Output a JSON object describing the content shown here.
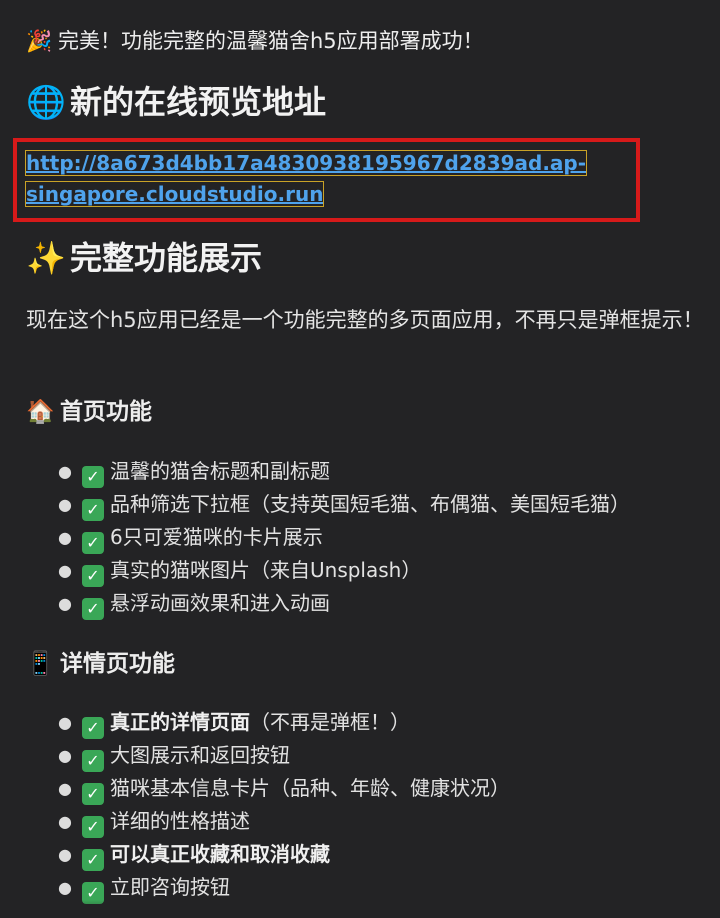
{
  "banner": {
    "icon": "party-popper-icon",
    "text": "完美！功能完整的温馨猫舍h5应用部署成功！"
  },
  "preview": {
    "icon": "globe-icon",
    "heading": "新的在线预览地址",
    "url": "http://8a673d4bb17a4830938195967d2839ad.ap-singapore.cloudstudio.run",
    "url_line1": "http://8a673d4bb17a4830938195967d2839ad.ap-",
    "url_line2": "singapore.cloudstudio.run",
    "highlight_color": "#d61a1a",
    "link_color": "#4fa3ec"
  },
  "features": {
    "icon": "sparkles-icon",
    "heading": "完整功能展示",
    "intro": "现在这个h5应用已经是一个功能完整的多页面应用，不再只是弹框提示！"
  },
  "home": {
    "icon": "house-icon",
    "heading": "首页功能",
    "items": [
      {
        "text": "温馨的猫舍标题和副标题",
        "bold": false
      },
      {
        "text": "品种筛选下拉框（支持英国短毛猫、布偶猫、美国短毛猫）",
        "bold": false
      },
      {
        "text": "6只可爱猫咪的卡片展示",
        "bold": false
      },
      {
        "text": "真实的猫咪图片（来自Unsplash）",
        "bold": false
      },
      {
        "text": "悬浮动画效果和进入动画",
        "bold": false
      }
    ]
  },
  "detail": {
    "icon": "mobile-phone-icon",
    "heading": "详情页功能",
    "items": [
      {
        "text": "真正的详情页面",
        "bold": true,
        "suffix": "（不再是弹框！）"
      },
      {
        "text": "大图展示和返回按钮",
        "bold": false,
        "suffix": ""
      },
      {
        "text": "猫咪基本信息卡片（品种、年龄、健康状况）",
        "bold": false,
        "suffix": ""
      },
      {
        "text": "详细的性格描述",
        "bold": false,
        "suffix": ""
      },
      {
        "text": "可以真正收藏和取消收藏",
        "bold": true,
        "suffix": ""
      },
      {
        "text": "立即咨询按钮",
        "bold": false,
        "suffix": ""
      }
    ]
  },
  "check_icon": "check-mark-icon",
  "check_color": "#3aa757"
}
